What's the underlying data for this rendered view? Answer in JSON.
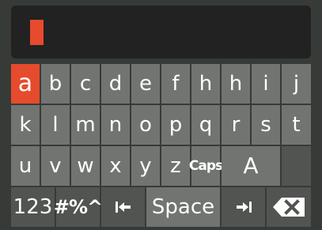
{
  "input": {
    "text": ""
  },
  "keyboard": {
    "row1": [
      "a",
      "b",
      "c",
      "d",
      "e",
      "f",
      "h",
      "h",
      "i",
      "j"
    ],
    "row2": [
      "k",
      "l",
      "m",
      "n",
      "o",
      "p",
      "q",
      "r",
      "s",
      "t"
    ],
    "row3": [
      "u",
      "v",
      "w",
      "x",
      "y",
      "z"
    ],
    "caps_label": "Caps",
    "shift_label": "A",
    "numbers_label": "123",
    "symbols_label": "#%^",
    "space_label": "Space",
    "selected_key": "a"
  },
  "colors": {
    "accent": "#e64b2e",
    "key": "#727472",
    "key_dark": "#525452",
    "background": "#373b38",
    "input_bg": "#212221"
  },
  "icons": {
    "cursor_left": "arrow-to-left-icon",
    "cursor_right": "arrow-to-right-icon",
    "backspace": "backspace-icon"
  }
}
